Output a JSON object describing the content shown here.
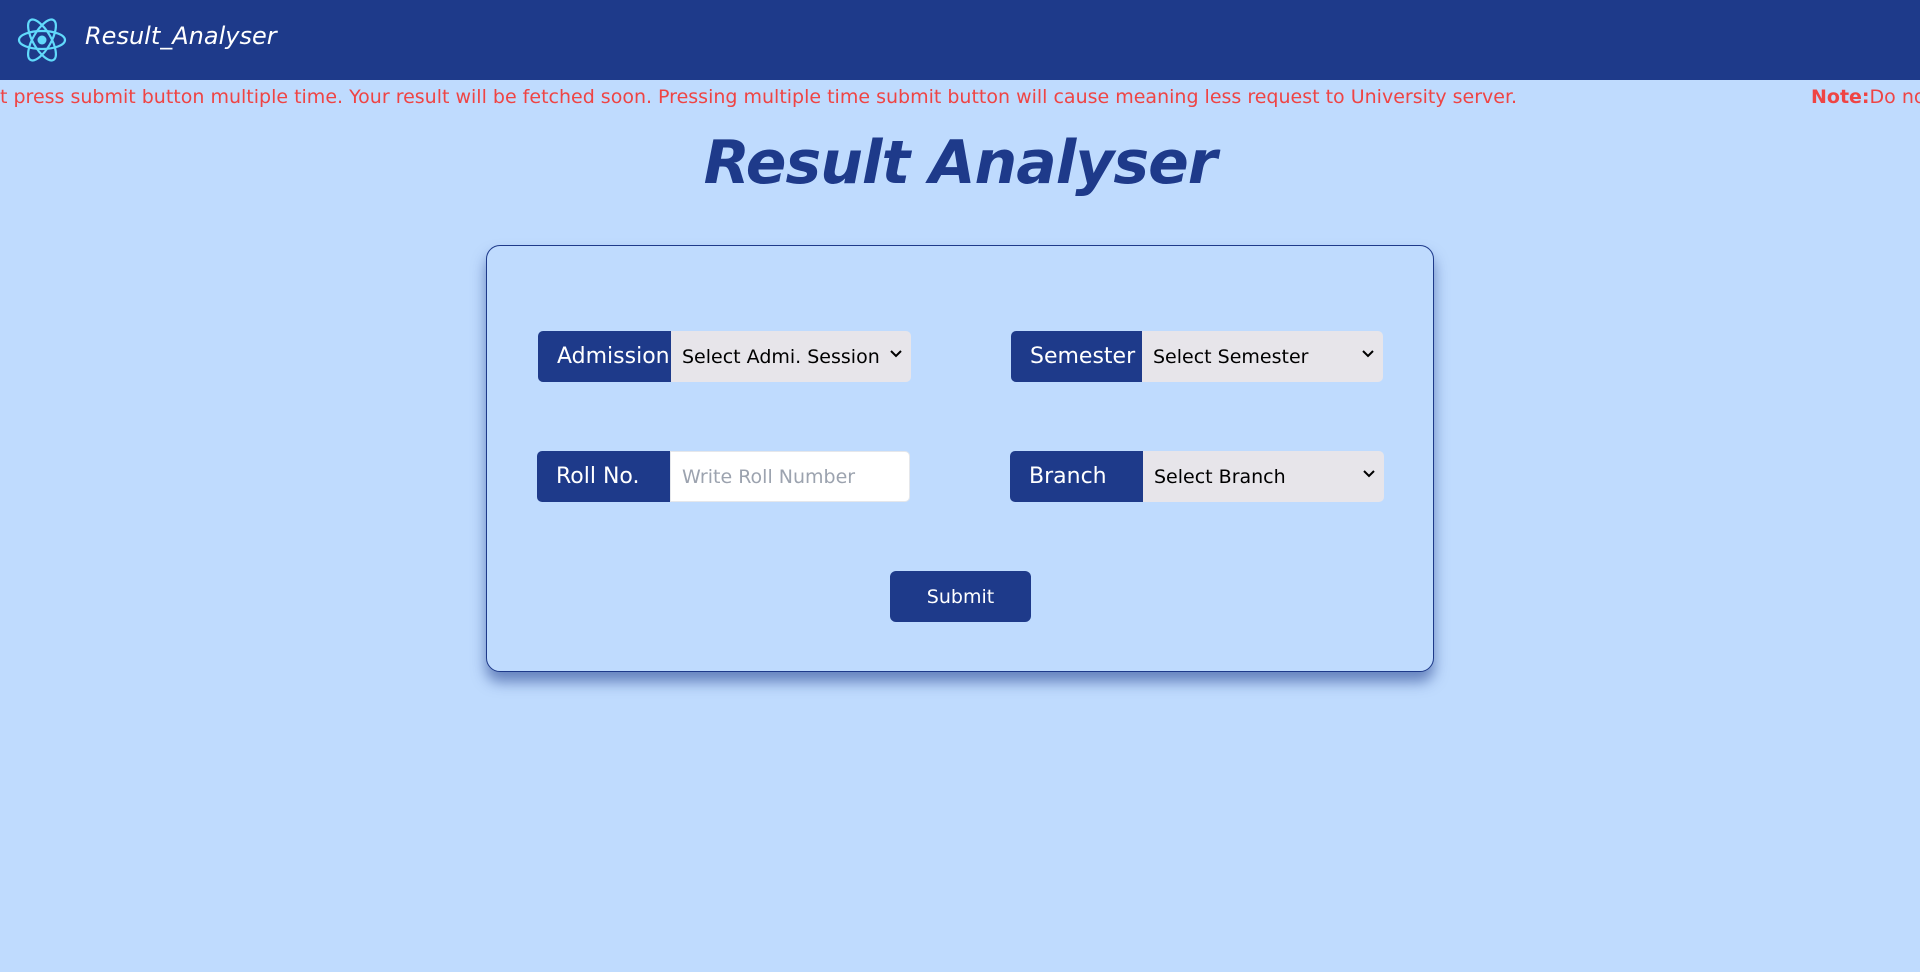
{
  "navbar": {
    "brand": "Result_Analyser",
    "logo_icon": "react-atom-icon",
    "logo_color": "#61dafb",
    "background": "#1e3a8a"
  },
  "notice": {
    "prefix": "Note:",
    "message": "Do not press submit button multiple time. Your result will be fetched soon. Pressing multiple time submit button will cause meaning less request to University server.",
    "visible_tail": "t press submit button multiple time. Your result will be fetched soon. Pressing multiple time submit button will cause meaning less request to University server.",
    "visible_head": "Do not",
    "color": "#ef4444"
  },
  "page": {
    "title": "Result Analyser",
    "background": "#bfdbfe",
    "accent": "#1e3a8a"
  },
  "form": {
    "admission": {
      "label": "Admission",
      "selected": "Select Admi. Session"
    },
    "semester": {
      "label": "Semester",
      "selected": "Select Semester"
    },
    "roll": {
      "label": "Roll No.",
      "placeholder": "Write Roll Number",
      "value": ""
    },
    "branch": {
      "label": "Branch",
      "selected": "Select Branch"
    },
    "submit_label": "Submit"
  }
}
